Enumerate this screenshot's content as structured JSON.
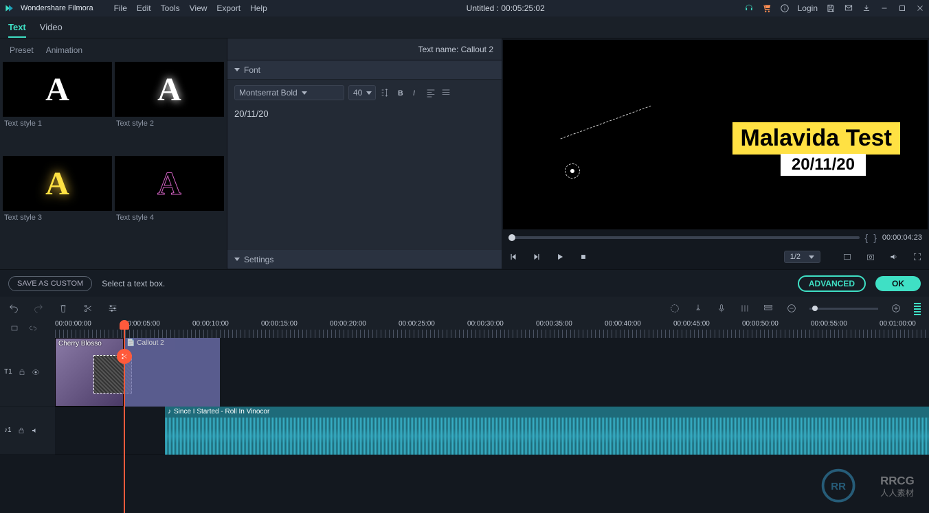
{
  "app": {
    "name": "Wondershare Filmora"
  },
  "menu": {
    "file": "File",
    "edit": "Edit",
    "tools": "Tools",
    "view": "View",
    "export": "Export",
    "help": "Help"
  },
  "title": "Untitled : 00:05:25:02",
  "login": "Login",
  "panelTabs": {
    "text": "Text",
    "video": "Video"
  },
  "presetTabs": {
    "preset": "Preset",
    "animation": "Animation"
  },
  "presets": [
    {
      "label": "Text style 1"
    },
    {
      "label": "Text style 2"
    },
    {
      "label": "Text style 3"
    },
    {
      "label": "Text style 4"
    }
  ],
  "textName": {
    "label": "Text name:",
    "value": "Callout 2"
  },
  "fontHdr": "Font",
  "settingsHdr": "Settings",
  "font": {
    "family": "Montserrat Bold",
    "size": "40"
  },
  "textValue": "20/11/20",
  "actions": {
    "saveCustom": "SAVE AS CUSTOM",
    "hint": "Select a text box.",
    "advanced": "ADVANCED",
    "ok": "OK"
  },
  "preview": {
    "title": "Malavida Test",
    "sub": "20/11/20",
    "timecode": "00:00:04:23",
    "ratio": "1/2"
  },
  "ruler": {
    "marks": [
      "00:00:00:00",
      "00:00:05:00",
      "00:00:10:00",
      "00:00:15:00",
      "00:00:20:00",
      "00:00:25:00",
      "00:00:30:00",
      "00:00:35:00",
      "00:00:40:00",
      "00:00:45:00",
      "00:00:50:00",
      "00:00:55:00",
      "00:01:00:00"
    ]
  },
  "tracks": {
    "t1": "T1",
    "a1": "♪1",
    "videoClip": "Cherry Blosso",
    "textClip": "Callout 2",
    "audioClip": "Since I Started - Roll In Vinocor"
  },
  "watermark": "RRCG\n人人素材"
}
